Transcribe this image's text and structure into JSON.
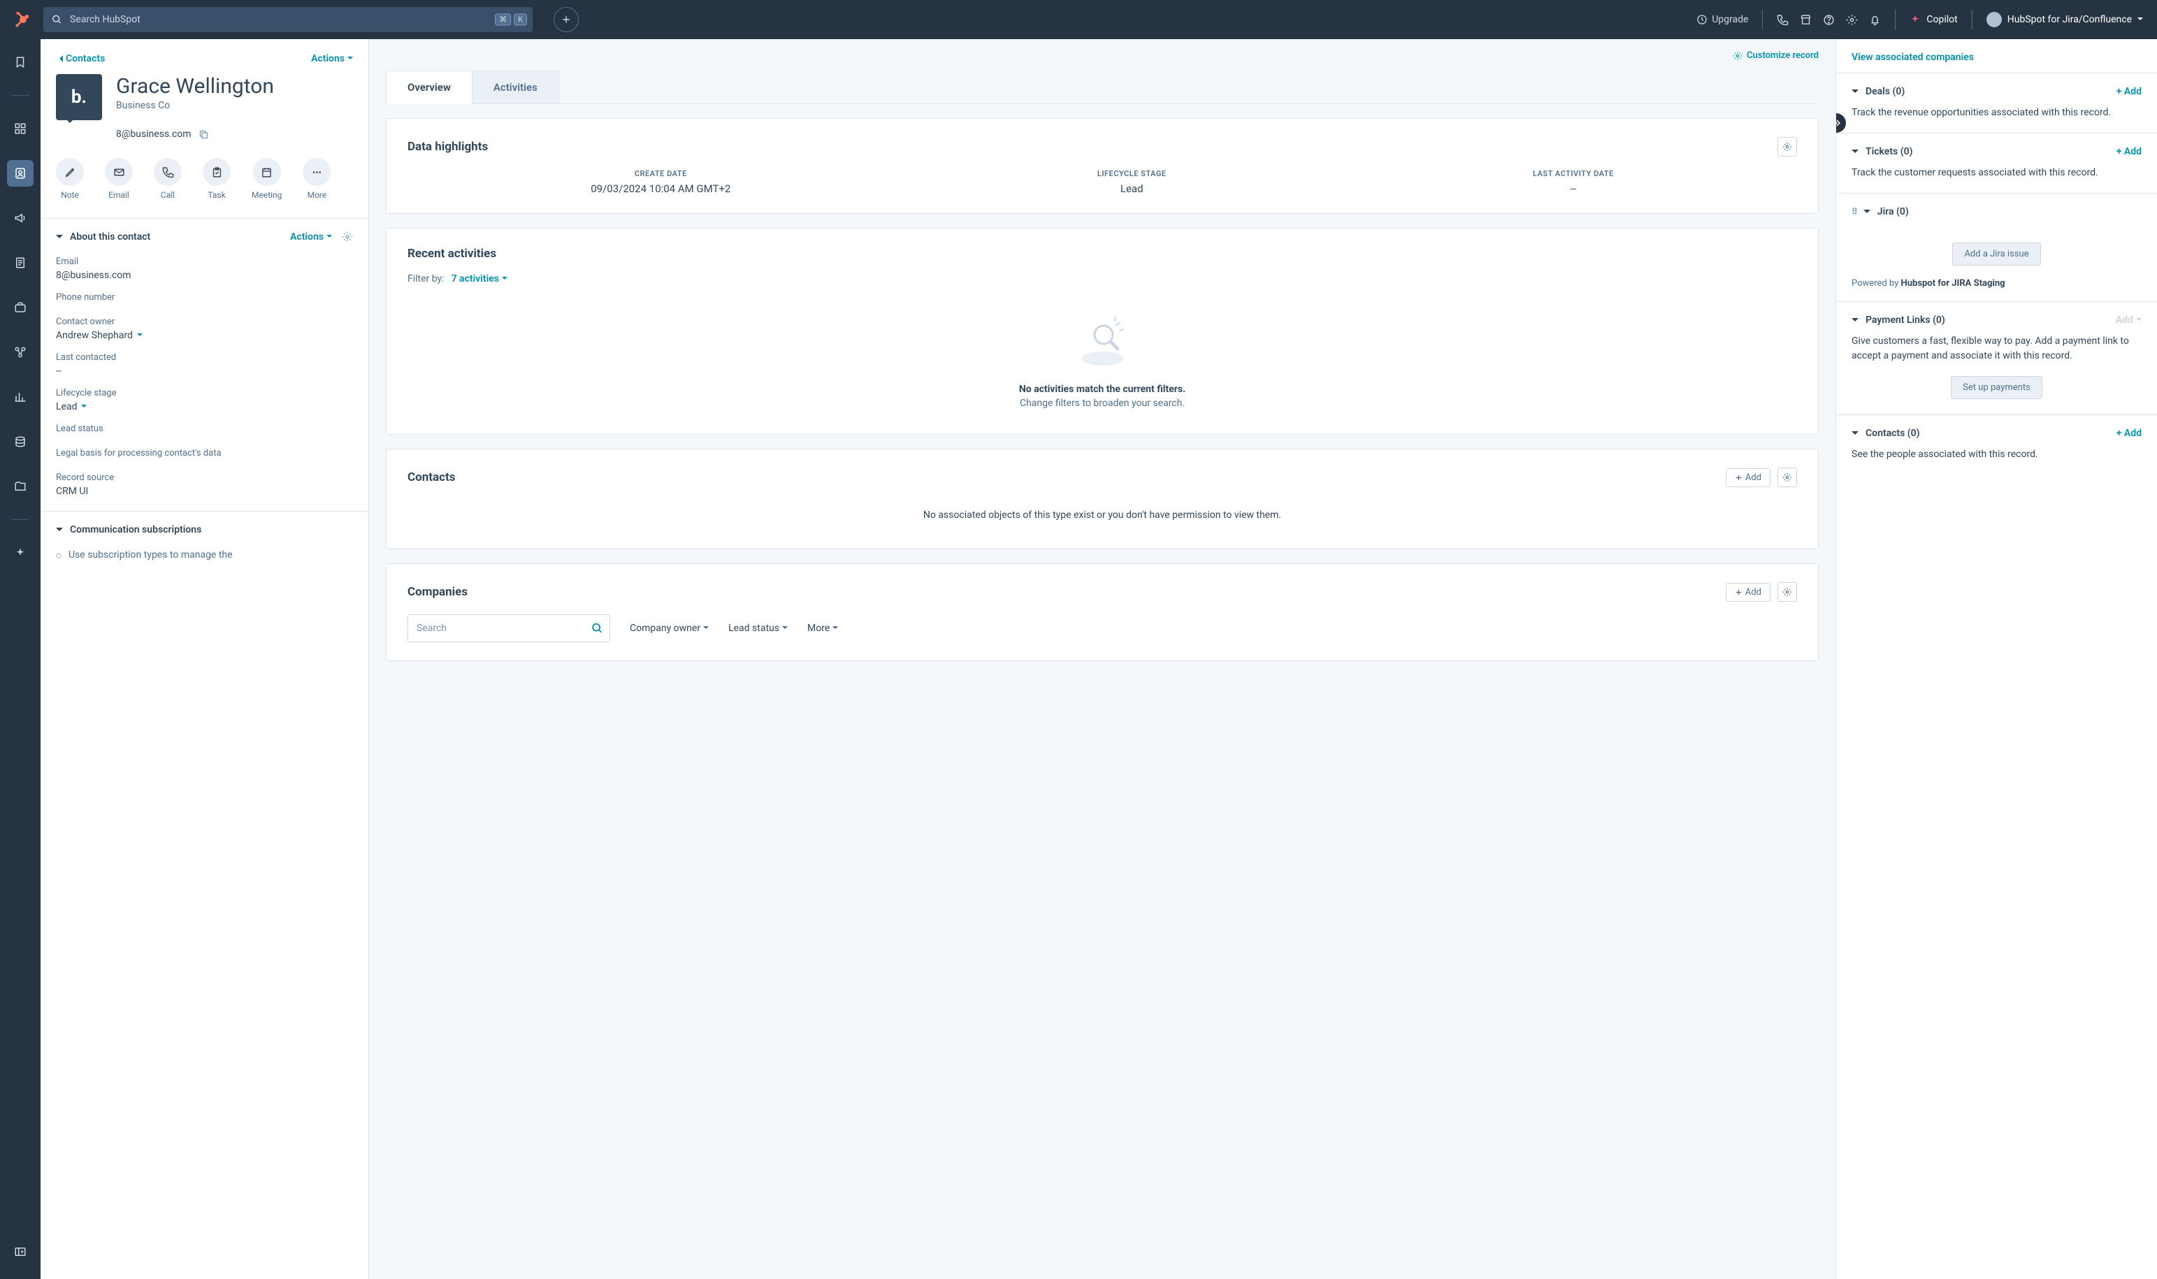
{
  "topnav": {
    "search_placeholder": "Search HubSpot",
    "shortcut_keys": [
      "⌘",
      "K"
    ],
    "upgrade": "Upgrade",
    "copilot": "Copilot",
    "workspace": "HubSpot for Jira/Confluence"
  },
  "leftcol": {
    "breadcrumb": "Contacts",
    "actions": "Actions",
    "name": "Grace Wellington",
    "company": "Business Co",
    "email": "8@business.com",
    "action_buttons": {
      "note": "Note",
      "email": "Email",
      "call": "Call",
      "task": "Task",
      "meeting": "Meeting",
      "more": "More"
    },
    "about": {
      "title": "About this contact",
      "actions": "Actions",
      "fields": {
        "email_label": "Email",
        "email_value": "8@business.com",
        "phone_label": "Phone number",
        "phone_value": "",
        "owner_label": "Contact owner",
        "owner_value": "Andrew Shephard",
        "last_contacted_label": "Last contacted",
        "last_contacted_value": "--",
        "lifecycle_label": "Lifecycle stage",
        "lifecycle_value": "Lead",
        "lead_status_label": "Lead status",
        "lead_status_value": "",
        "legal_label": "Legal basis for processing contact's data",
        "legal_value": "",
        "source_label": "Record source",
        "source_value": "CRM UI"
      }
    },
    "comsub": {
      "title": "Communication subscriptions",
      "desc": "Use subscription types to manage the"
    }
  },
  "mid": {
    "customize": "Customize record",
    "tabs": {
      "overview": "Overview",
      "activities": "Activities"
    },
    "datahl": {
      "title": "Data highlights",
      "create_label": "CREATE DATE",
      "create_value": "09/03/2024 10:04 AM GMT+2",
      "lifecycle_label": "LIFECYCLE STAGE",
      "lifecycle_value": "Lead",
      "lastact_label": "LAST ACTIVITY DATE",
      "lastact_value": "--"
    },
    "recent": {
      "title": "Recent activities",
      "filter_label": "Filter by:",
      "filter_value": "7 activities",
      "empty_title": "No activities match the current filters.",
      "empty_sub": "Change filters to broaden your search."
    },
    "contacts": {
      "title": "Contacts",
      "add": "Add",
      "empty": "No associated objects of this type exist or you don't have permission to view them."
    },
    "companies": {
      "title": "Companies",
      "add": "Add",
      "search_placeholder": "Search",
      "f_owner": "Company owner",
      "f_lead": "Lead status",
      "f_more": "More"
    }
  },
  "right": {
    "view_companies": "View associated companies",
    "deals": {
      "title": "Deals (0)",
      "add": "+ Add",
      "body": "Track the revenue opportunities associated with this record."
    },
    "tickets": {
      "title": "Tickets (0)",
      "add": "+ Add",
      "body": "Track the customer requests associated with this record."
    },
    "jira": {
      "title": "Jira (0)",
      "btn": "Add a Jira issue",
      "powered_prefix": "Powered by ",
      "powered_name": "Hubspot for JIRA Staging"
    },
    "payment": {
      "title": "Payment Links (0)",
      "add": "Add",
      "body": "Give customers a fast, flexible way to pay. Add a payment link to accept a payment and associate it with this record.",
      "btn": "Set up payments"
    },
    "contacts": {
      "title": "Contacts (0)",
      "add": "+ Add",
      "body": "See the people associated with this record."
    }
  }
}
